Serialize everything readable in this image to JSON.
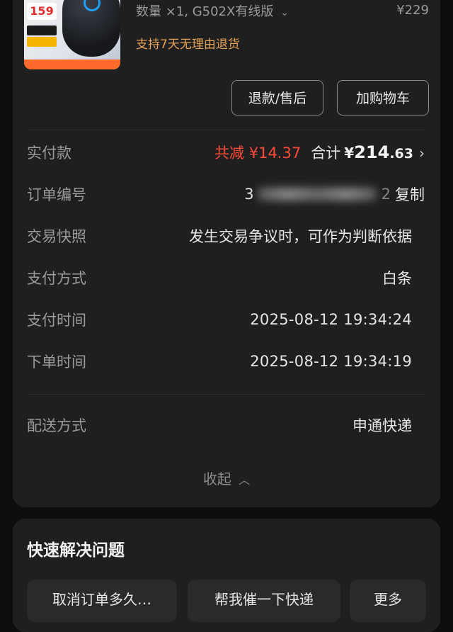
{
  "product": {
    "thumb_price": "159",
    "spec": "数量 ×1, G502X有线版",
    "price": "¥229",
    "return_note": "支持7天无理由退货"
  },
  "actions": {
    "refund_label": "退款/售后",
    "cart_label": "加购物车"
  },
  "payment": {
    "label": "实付款",
    "discount": "共减 ¥14.37",
    "total_label": "合计",
    "total_currency": "¥",
    "total_int": "214",
    "total_dec": ".63"
  },
  "details": [
    {
      "label": "订单编号",
      "value_prefix": "3",
      "value_suffix": "2",
      "action": "复制"
    },
    {
      "label": "交易快照",
      "value": "发生交易争议时，可作为判断依据"
    },
    {
      "label": "支付方式",
      "value": "白条"
    },
    {
      "label": "支付时间",
      "value": "2025-08-12 19:34:24"
    },
    {
      "label": "下单时间",
      "value": "2025-08-12 19:34:19"
    }
  ],
  "delivery": {
    "label": "配送方式",
    "value": "申通快递"
  },
  "collapse_label": "收起",
  "quick": {
    "title": "快速解决问题",
    "chips": [
      "取消订单多久…",
      "帮我催一下快递",
      "更多"
    ]
  }
}
